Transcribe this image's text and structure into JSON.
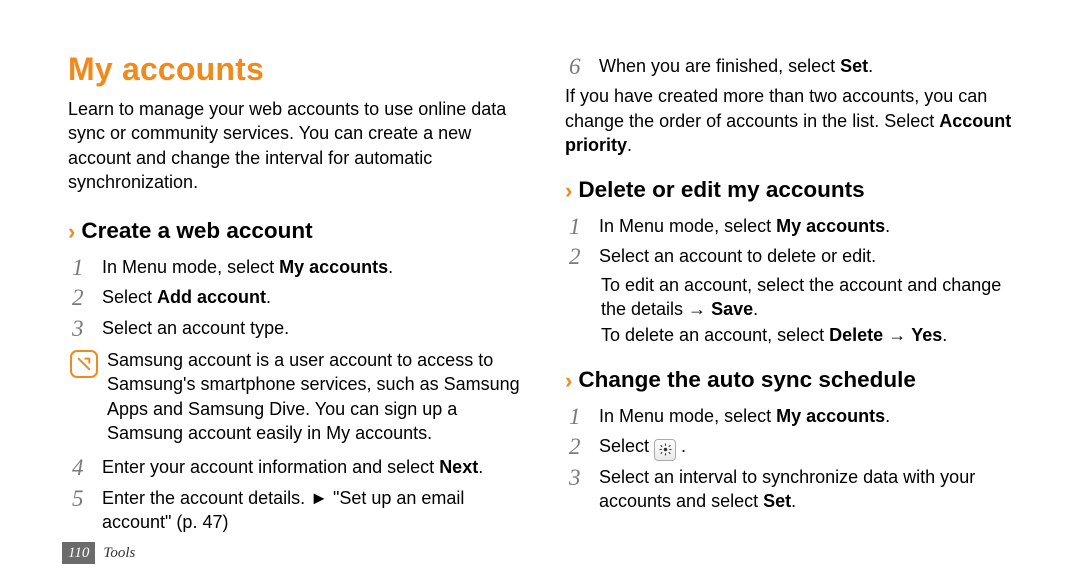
{
  "left": {
    "heading": "My accounts",
    "intro": "Learn to manage your web accounts to use online data sync or community services. You can create a new account and change the interval for automatic synchronization.",
    "section1": {
      "title": "Create a web account",
      "step1_a": "In Menu mode, select ",
      "step1_b": "My accounts",
      "step1_c": ".",
      "step2_a": "Select ",
      "step2_b": "Add account",
      "step2_c": ".",
      "step3": "Select an account type.",
      "note": "Samsung account is a user account to access to Samsung's smartphone services, such as Samsung Apps and Samsung Dive. You can sign up a Samsung account easily in My accounts.",
      "step4_a": "Enter your account information and select ",
      "step4_b": "Next",
      "step4_c": ".",
      "step5_a": "Enter the account details. ► \"Set up an email account\" (p. 47)"
    }
  },
  "right": {
    "step6_a": "When you are finished, select ",
    "step6_b": "Set",
    "step6_c": ".",
    "cont_a": "If you have created more than two accounts, you can change the order of accounts in the list. Select ",
    "cont_b": "Account priority",
    "cont_c": ".",
    "section2": {
      "title": "Delete or edit my accounts",
      "step1_a": "In Menu mode, select ",
      "step1_b": "My accounts",
      "step1_c": ".",
      "step2": "Select an account to delete or edit.",
      "sub1_a": "To edit an account, select the account and change the details → ",
      "sub1_b": "Save",
      "sub1_c": ".",
      "sub2_a": "To delete an account, select ",
      "sub2_b": "Delete",
      "sub2_c": " → ",
      "sub2_d": "Yes",
      "sub2_e": "."
    },
    "section3": {
      "title": "Change the auto sync schedule",
      "step1_a": "In Menu mode, select ",
      "step1_b": "My accounts",
      "step1_c": ".",
      "step2_a": "Select ",
      "step2_b": ".",
      "step3_a": "Select an interval to synchronize data with your accounts and select ",
      "step3_b": "Set",
      "step3_c": "."
    }
  },
  "footer": {
    "page": "110",
    "chapter": "Tools"
  },
  "nums": {
    "n1": "1",
    "n2": "2",
    "n3": "3",
    "n4": "4",
    "n5": "5",
    "n6": "6"
  },
  "chevron": "›"
}
